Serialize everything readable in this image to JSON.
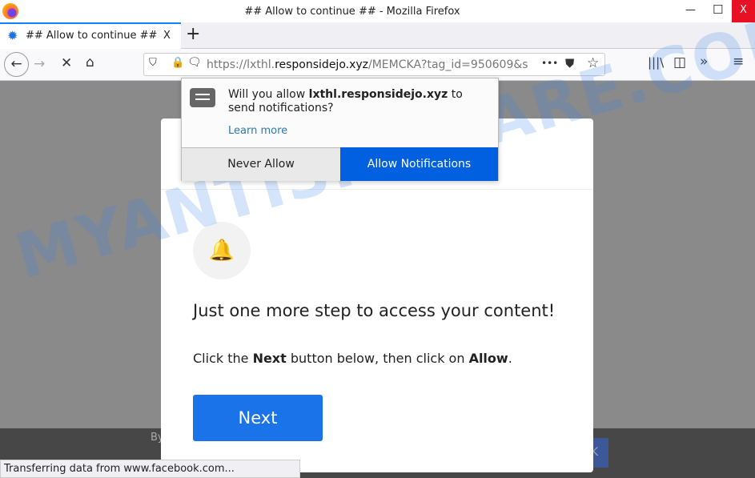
{
  "window": {
    "title": "## Allow to continue ## - Mozilla Firefox",
    "minimize": "—",
    "maximize": "☐",
    "close": "X"
  },
  "tab": {
    "label": "## Allow to continue ##",
    "close": "X",
    "new_tab": "+"
  },
  "nav": {
    "url_host_pre": "https://lxthl.",
    "url_host_domain": "responsidejo.xyz",
    "url_path": "/MEMCKA?tag_id=950609&s",
    "more": "•••"
  },
  "popup": {
    "text_pre": "Will you allow ",
    "domain": "lxthl.responsidejo.xyz",
    "text_post": " to send notifications?",
    "learn_more": "Learn more",
    "never_allow": "Never Allow",
    "allow": "Allow Notifications",
    "allow_color": "#0060df"
  },
  "modal": {
    "heading": "Just one more step to access your content!",
    "instr_pre": "Click the ",
    "instr_next": "Next",
    "instr_mid": " button below, then click on ",
    "instr_allow": "Allow",
    "instr_end": ".",
    "next_button": "Next",
    "button_color": "#1a73e8"
  },
  "background": {
    "footer_fragment": "By",
    "button_fragment": "K"
  },
  "status": "Transferring data from www.facebook.com...",
  "watermark": "MYANTISPYWARE.COM"
}
